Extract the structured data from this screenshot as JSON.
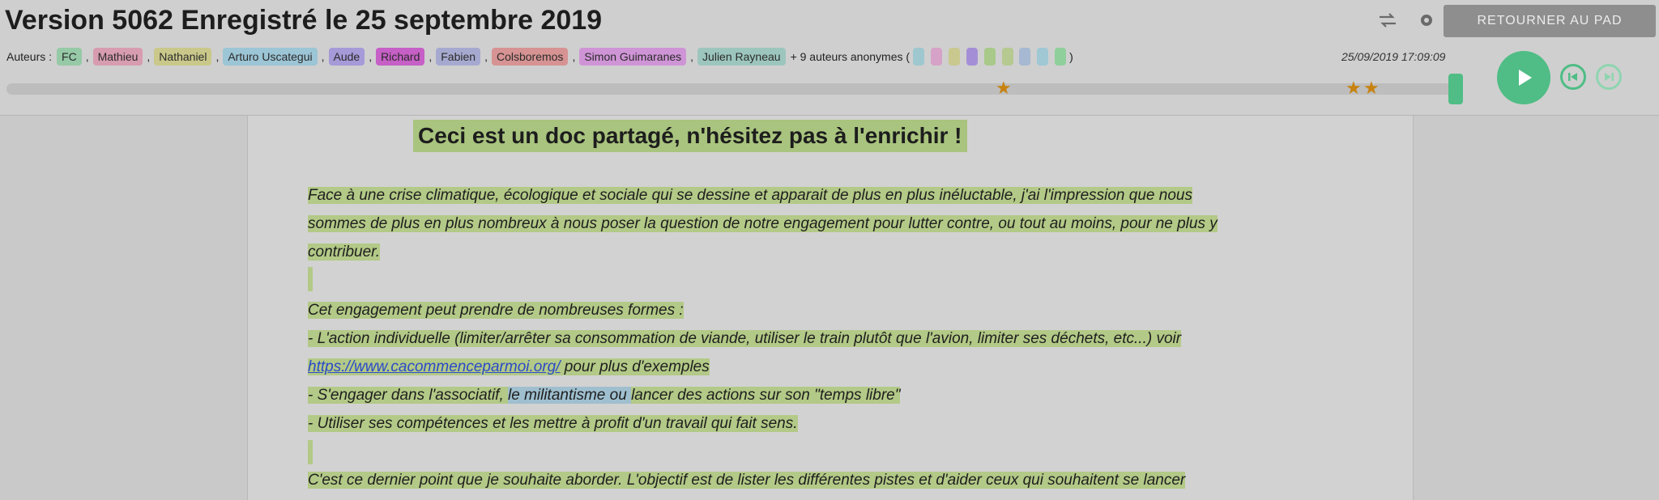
{
  "header": {
    "title": "Version 5062 Enregistré le 25 septembre 2019",
    "return_label": "RETOURNER AU PAD",
    "timestamp": "25/09/2019 17:09:09"
  },
  "authors": {
    "label": "Auteurs :",
    "list": [
      {
        "name": "FC",
        "color": "#96c9a6"
      },
      {
        "name": "Mathieu",
        "color": "#d79cb0"
      },
      {
        "name": "Nathaniel",
        "color": "#c9c88a"
      },
      {
        "name": "Arturo Uscategui",
        "color": "#9cc5d6"
      },
      {
        "name": "Aude",
        "color": "#a69ad8"
      },
      {
        "name": "Richard",
        "color": "#c65fc6"
      },
      {
        "name": "Fabien",
        "color": "#a6a9cf"
      },
      {
        "name": "Colsboremos",
        "color": "#d79393"
      },
      {
        "name": "Simon Guimaranes",
        "color": "#cf94d6"
      },
      {
        "name": "Julien Rayneau",
        "color": "#9cc6bd"
      }
    ],
    "anon_text": "+ 9 auteurs anonymes (",
    "anon_close": ")",
    "anon_colors": [
      "#9ec7cf",
      "#d6a2c8",
      "#c9c88e",
      "#a48fd6",
      "#a8c98a",
      "#b5c990",
      "#a6b8d2",
      "#9fc7d4",
      "#8fcf9b"
    ]
  },
  "icons": {
    "swap": "swap-icon",
    "settings": "gear-icon",
    "play": "play-icon",
    "step_back": "step-backward-icon",
    "step_forward": "step-forward-icon",
    "star": "star-icon"
  },
  "colors": {
    "accent": "#4fbd85",
    "star": "#c7820f",
    "highlight_green": "#b3c987",
    "highlight_blue": "#9fbfcf"
  },
  "timeline": {
    "position": 1.0,
    "stars": [
      "★",
      "★",
      "★"
    ]
  },
  "document": {
    "title": "Ceci est un doc partagé, n'hésitez pas à l'enrichir !",
    "p1": [
      "Face à une crise climatique, écologique et sociale qui se dessine et apparait de plus en plus inéluctable,  j'ai l'impression que nous",
      "sommes de plus en plus nombreux à nous poser la question de notre engagement pour lutter contre, ou tout au moins, pour ne plus y",
      "contribuer."
    ],
    "p2_intro": "Cet engagement peut prendre de nombreuses formes :",
    "p2_item1": " - L'action individuelle (limiter/arrêter sa consommation de viande, utiliser le train plutôt que l'avion, limiter ses déchets, etc...) voir",
    "p2_link": "https://www.cacommenceparmoi.org/",
    "p2_link_suffix": " pour plus d'exemples",
    "p2_item2_a": " - S'engager dans l'associatif, ",
    "p2_item2_b": "le militantisme ou ",
    "p2_item2_c": " lancer des actions sur son \"temps libre\"",
    "p2_item3": " - Utiliser ses compétences et les mettre à profit d'un travail qui fait sens.",
    "p3": "C'est ce dernier point que je souhaite aborder. L'objectif est de lister les différentes pistes et d'aider ceux qui souhaitent se lancer"
  }
}
